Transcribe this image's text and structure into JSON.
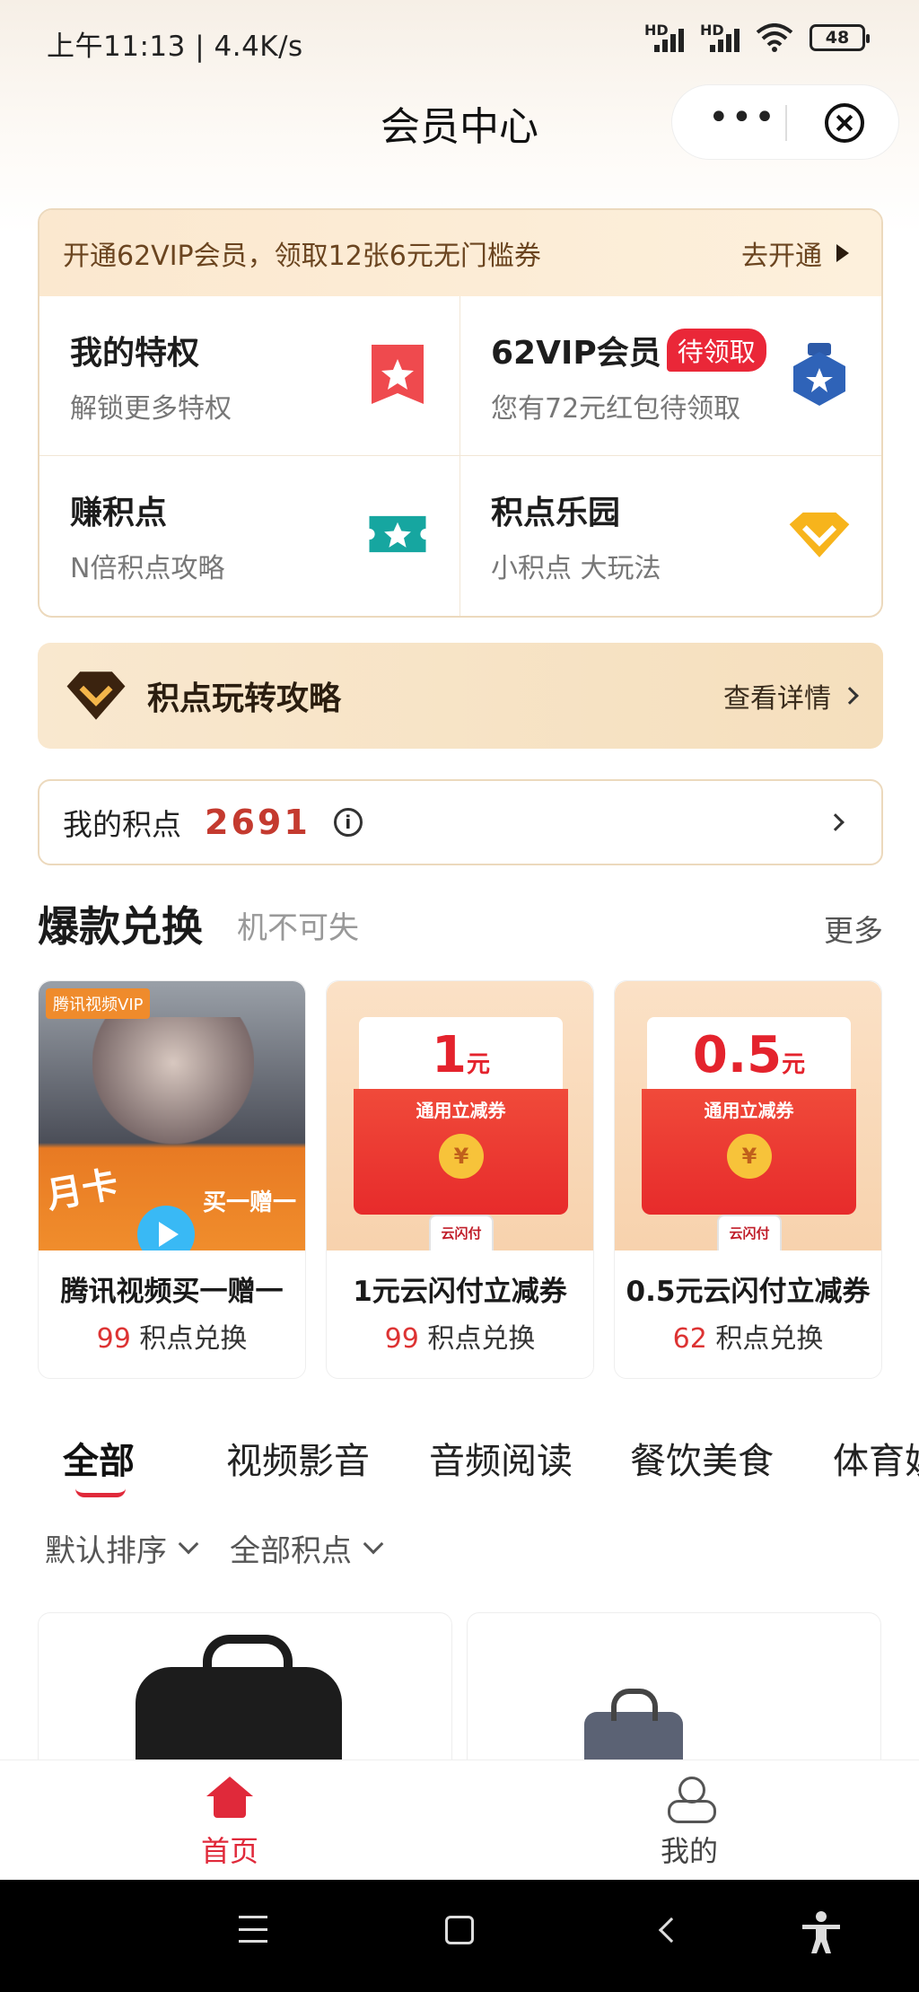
{
  "status_bar": {
    "time": "上午11:13 | 4.4K/s",
    "battery": "48",
    "network_1": "HD",
    "network_2": "HD"
  },
  "header": {
    "title": "会员中心",
    "more_glyph": "•••"
  },
  "promo": {
    "text": "开通62VIP会员，领取12张6元无门槛券",
    "action": "去开通",
    "tiles": [
      {
        "title": "我的特权",
        "subtitle": "解锁更多特权",
        "icon": "star-bookmark-icon"
      },
      {
        "title": "62VIP会员",
        "badge": "待领取",
        "subtitle": "您有72元红包待领取",
        "icon": "medal-icon"
      },
      {
        "title": "赚积点",
        "subtitle": "N倍积点攻略",
        "icon": "ticket-star-icon"
      },
      {
        "title": "积点乐园",
        "subtitle": "小积点 大玩法",
        "icon": "diamond-icon"
      }
    ]
  },
  "strategy": {
    "title": "积点玩转攻略",
    "action": "查看详情"
  },
  "points": {
    "label": "我的积点",
    "value": "2691",
    "info_glyph": "i"
  },
  "hot_exchange": {
    "title": "爆款兑换",
    "subtitle": "机不可失",
    "more": "更多",
    "items": [
      {
        "name": "腾讯视频买一赠一",
        "cost": "99",
        "unit": "积点兑换",
        "img_vip": "腾讯视频VIP",
        "img_card": "月卡",
        "img_promo": "买一赠一"
      },
      {
        "name": "1元云闪付立减券",
        "cost": "99",
        "unit": "积点兑换",
        "amount": "1",
        "currency": "元",
        "coupon": "通用立减券",
        "coin": "¥",
        "brand": "云闪付"
      },
      {
        "name": "0.5元云闪付立减券",
        "cost": "62",
        "unit": "积点兑换",
        "amount": "0.5",
        "currency": "元",
        "coupon": "通用立减券",
        "coin": "¥",
        "brand": "云闪付"
      }
    ]
  },
  "categories": [
    "全部",
    "视频影音",
    "音频阅读",
    "餐饮美食",
    "体育娱"
  ],
  "filters": {
    "sort": "默认排序",
    "range": "全部积点"
  },
  "tabbar": {
    "home": "首页",
    "me": "我的"
  },
  "colors": {
    "accent": "#e0293a",
    "gold_bg": "#fbe8cf",
    "points_value": "#c43a2f"
  }
}
